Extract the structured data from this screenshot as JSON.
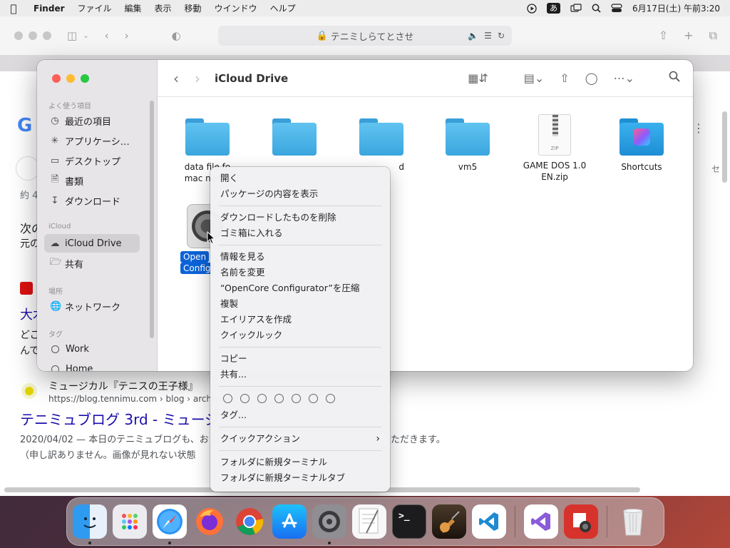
{
  "menubar": {
    "app": "Finder",
    "items": [
      "ファイル",
      "編集",
      "表示",
      "移動",
      "ウインドウ",
      "ヘルプ"
    ],
    "ime": "あ",
    "clock": "6月17日(土) 午前3:20"
  },
  "safari": {
    "url": "テニミしらてとさせ",
    "page": {
      "logo": "G",
      "results_count": "約 4",
      "line1": "次の",
      "line2": "元の",
      "line3": "大木",
      "line4": "どこ",
      "line5": "んで",
      "right_char": "セ",
      "result_title": "ミュージカル『テニスの王子様』",
      "result_url": "https://blog.tennimu.com › blog › archives ›",
      "result_link": "テニミュブログ 3rd - ミュージ",
      "result_date_snip": "2020/04/02 — 本日のテニミュブログも、お",
      "result_snip_tail": "ただきます。",
      "result_snip2": "（申し訳ありません。画像が見れない状態"
    }
  },
  "finder": {
    "title": "iCloud Drive",
    "sidebar": {
      "favorites_header": "よく使う項目",
      "favorites": [
        {
          "label": "最近の項目",
          "icon": "clock-icon"
        },
        {
          "label": "アプリケーシ…",
          "icon": "applications-icon"
        },
        {
          "label": "デスクトップ",
          "icon": "desktop-icon"
        },
        {
          "label": "書類",
          "icon": "document-icon"
        },
        {
          "label": "ダウンロード",
          "icon": "download-icon"
        }
      ],
      "icloud_header": "iCloud",
      "icloud": [
        {
          "label": "iCloud Drive",
          "icon": "cloud-icon"
        },
        {
          "label": "共有",
          "icon": "shared-folder-icon"
        }
      ],
      "locations_header": "場所",
      "locations": [
        {
          "label": "ネットワーク",
          "icon": "network-icon"
        }
      ],
      "tags_header": "タグ",
      "tags": [
        {
          "label": "Work"
        },
        {
          "label": "Home"
        }
      ]
    },
    "files": [
      {
        "label": "data file fo",
        "label2": "mac not m",
        "kind": "folder"
      },
      {
        "label": "",
        "kind": "folder"
      },
      {
        "label": "d",
        "kind": "folder"
      },
      {
        "label": "vm5",
        "kind": "folder"
      },
      {
        "label": "GAME DOS 1.0",
        "label2": "EN.zip",
        "kind": "zip",
        "badge": "ZIP"
      },
      {
        "label": "Shortcuts",
        "kind": "shortcuts"
      },
      {
        "label": "Open",
        "label2": "Config",
        "kind": "app-selected"
      }
    ]
  },
  "context_menu": {
    "group1": [
      "開く",
      "パッケージの内容を表示"
    ],
    "group2": [
      "ダウンロードしたものを削除",
      "ゴミ箱に入れる"
    ],
    "group3": [
      "情報を見る",
      "名前を変更",
      "“OpenCore Configurator”を圧縮",
      "複製",
      "エイリアスを作成",
      "クイックルック"
    ],
    "group4": [
      "コピー",
      "共有..."
    ],
    "tags_label": "タグ...",
    "quick_actions": "クイックアクション",
    "group6": [
      "フォルダに新規ターミナル",
      "フォルダに新規ターミナルタブ"
    ]
  },
  "dock": {
    "apps": [
      {
        "name": "finder",
        "running": true
      },
      {
        "name": "launchpad",
        "running": false
      },
      {
        "name": "safari",
        "running": true
      },
      {
        "name": "firefox",
        "running": false
      },
      {
        "name": "chrome",
        "running": false
      },
      {
        "name": "app-store",
        "running": false
      },
      {
        "name": "system-preferences",
        "running": true
      },
      {
        "name": "textedit",
        "running": false
      },
      {
        "name": "terminal",
        "running": false
      },
      {
        "name": "garageband",
        "running": false
      },
      {
        "name": "vscode",
        "running": false
      },
      {
        "name": "visual-studio",
        "running": false
      },
      {
        "name": "photo-booth",
        "running": false
      },
      {
        "name": "trash",
        "running": false
      }
    ]
  }
}
